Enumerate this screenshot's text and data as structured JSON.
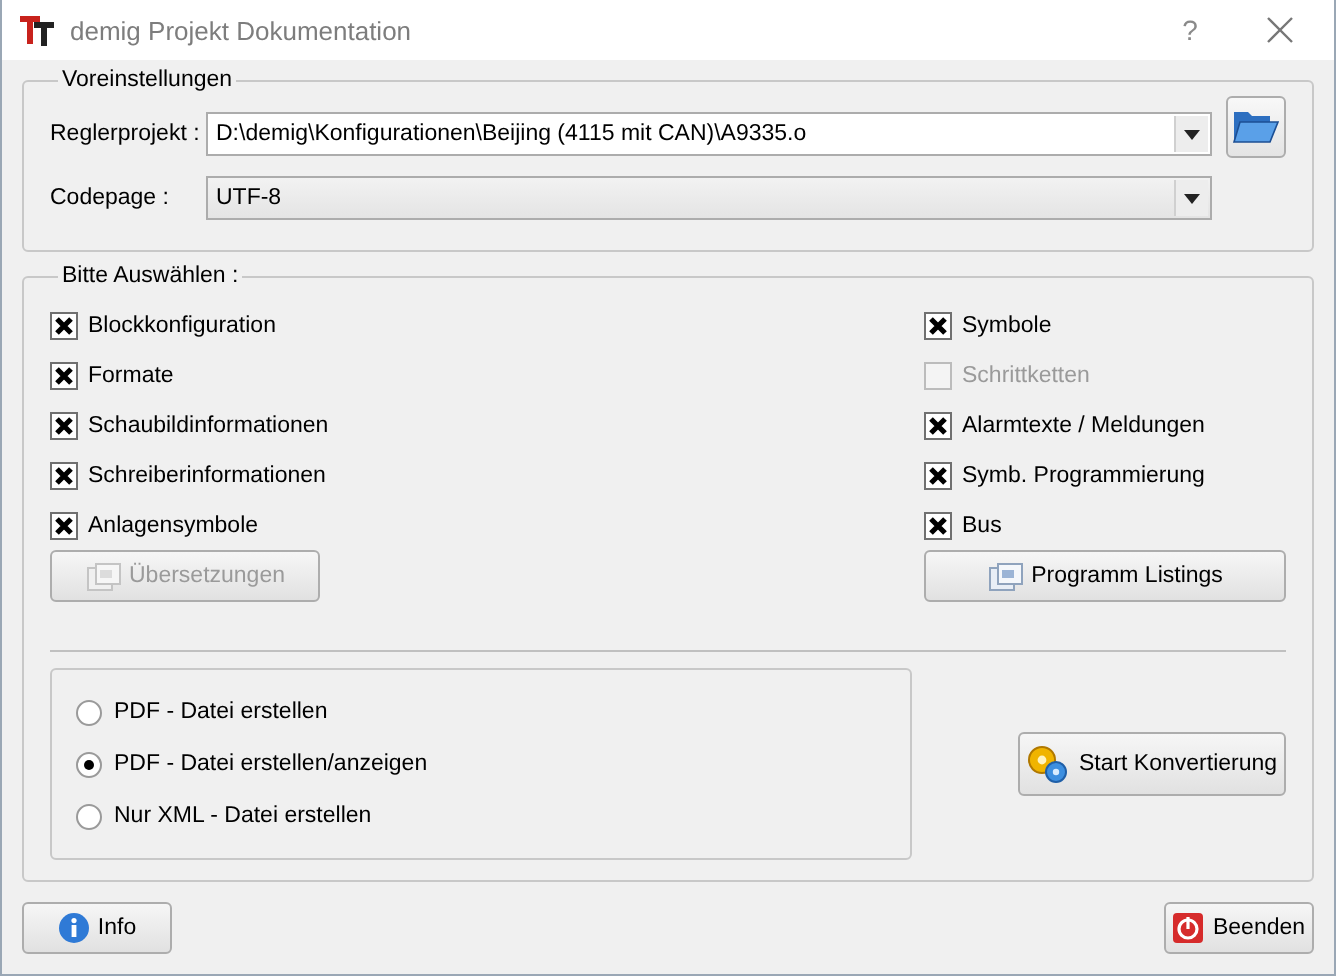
{
  "window": {
    "title": "demig Projekt Dokumentation",
    "help": "?"
  },
  "presets": {
    "title": "Voreinstellungen",
    "fields": [
      {
        "label": "Reglerprojekt :",
        "value": "D:\\demig\\Konfigurationen\\Beijing (4115 mit CAN)\\A9335.o",
        "browse": true
      },
      {
        "label": "Codepage :",
        "value": "UTF-8",
        "browse": false
      }
    ]
  },
  "selection": {
    "title": "Bitte Auswählen :",
    "left": [
      {
        "label": "Blockkonfiguration",
        "checked": true,
        "disabled": false
      },
      {
        "label": "Formate",
        "checked": true,
        "disabled": false
      },
      {
        "label": "Schaubildinformationen",
        "checked": true,
        "disabled": false
      },
      {
        "label": "Schreiberinformationen",
        "checked": true,
        "disabled": false
      },
      {
        "label": "Anlagensymbole",
        "checked": true,
        "disabled": false
      }
    ],
    "right": [
      {
        "label": "Symbole",
        "checked": true,
        "disabled": false
      },
      {
        "label": "Schrittketten",
        "checked": false,
        "disabled": true
      },
      {
        "label": "Alarmtexte / Meldungen",
        "checked": true,
        "disabled": false
      },
      {
        "label": "Symb. Programmierung",
        "checked": true,
        "disabled": false
      },
      {
        "label": "Bus",
        "checked": true,
        "disabled": false
      }
    ],
    "left_button": {
      "label": "Übersetzungen",
      "disabled": true
    },
    "right_button": {
      "label": "Programm Listings",
      "disabled": false
    },
    "output": [
      {
        "label": "PDF - Datei erstellen",
        "selected": false
      },
      {
        "label": "PDF - Datei erstellen/anzeigen",
        "selected": true
      },
      {
        "label": "Nur XML - Datei erstellen",
        "selected": false
      }
    ],
    "start_button": "Start Konvertierung"
  },
  "footer": {
    "info": "Info",
    "quit": "Beenden"
  }
}
